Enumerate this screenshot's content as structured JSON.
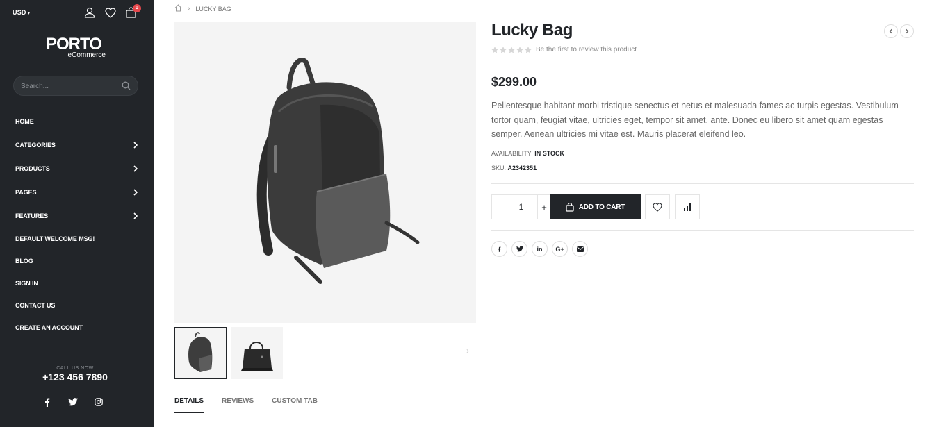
{
  "sidebar": {
    "currency": "USD",
    "cart_count": "0",
    "logo_main": "PORTO",
    "logo_sub": "eCommerce",
    "search_placeholder": "Search...",
    "nav": [
      {
        "label": "HOME",
        "has_arrow": false
      },
      {
        "label": "CATEGORIES",
        "has_arrow": true
      },
      {
        "label": "PRODUCTS",
        "has_arrow": true
      },
      {
        "label": "PAGES",
        "has_arrow": true
      },
      {
        "label": "FEATURES",
        "has_arrow": true
      },
      {
        "label": "DEFAULT WELCOME MSG!",
        "has_arrow": false
      },
      {
        "label": "BLOG",
        "has_arrow": false
      },
      {
        "label": "SIGN IN",
        "has_arrow": false
      },
      {
        "label": "CONTACT US",
        "has_arrow": false
      },
      {
        "label": "CREATE AN ACCOUNT",
        "has_arrow": false
      }
    ],
    "call_label": "CALL US NOW",
    "phone": "+123 456 7890",
    "social": [
      "facebook-icon",
      "twitter-icon",
      "instagram-icon"
    ]
  },
  "breadcrumb": {
    "current": "LUCKY BAG"
  },
  "product": {
    "title": "Lucky Bag",
    "rating_text": "Be the first to review this product",
    "rating_stars": 0,
    "price": "$299.00",
    "description": "Pellentesque habitant morbi tristique senectus et netus et malesuada fames ac turpis egestas. Vestibulum tortor quam, feugiat vitae, ultricies eget, tempor sit amet, ante. Donec eu libero sit amet quam egestas semper. Aenean ultricies mi vitae est. Mauris placerat eleifend leo.",
    "availability_label": "AVAILABILITY:",
    "availability_value": "IN STOCK",
    "sku_label": "SKU:",
    "sku_value": "A2342351",
    "qty": "1",
    "add_to_cart": "ADD TO CART",
    "share": [
      "f",
      "t",
      "in",
      "G+",
      "mail"
    ]
  },
  "tabs": [
    {
      "label": "DETAILS",
      "active": true
    },
    {
      "label": "REVIEWS",
      "active": false
    },
    {
      "label": "CUSTOM TAB",
      "active": false
    }
  ],
  "colors": {
    "dark": "#222529",
    "badge": "#e5484d",
    "muted": "#777777"
  }
}
